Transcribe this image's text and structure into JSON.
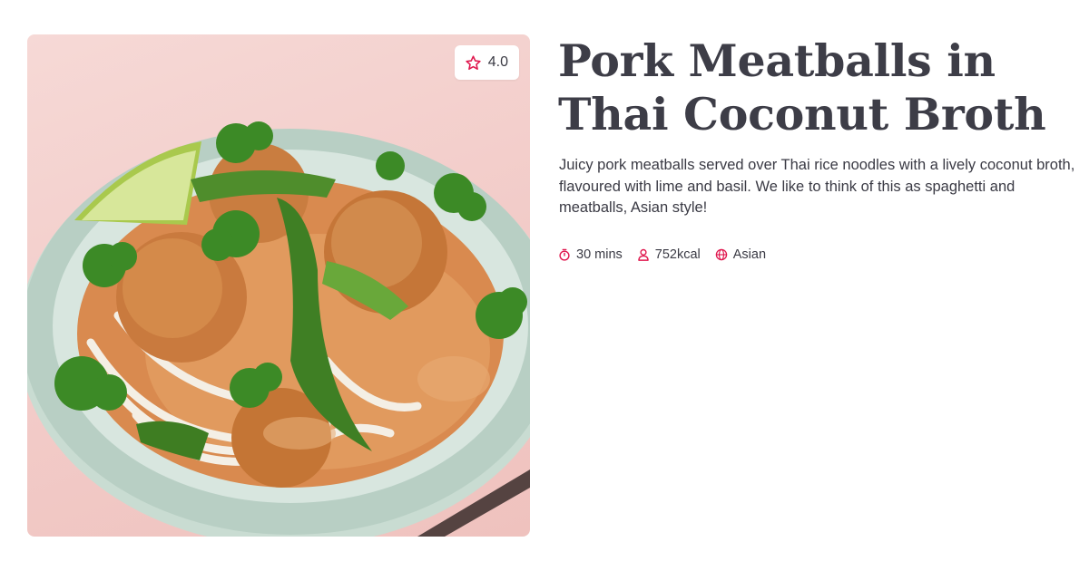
{
  "recipe": {
    "title": "Pork Meatballs in Thai Coconut Broth",
    "description": "Juicy pork meatballs served over Thai rice noodles with a lively coconut broth, flavoured with lime and basil. We like to think of this as spaghetti and meatballs, Asian style!",
    "rating": "4.0",
    "image_alt": "Bowl of pork meatballs in orange coconut broth over rice noodles with snow peas, coriander and a lime wedge"
  },
  "meta": {
    "time": "30 mins",
    "calories": "752kcal",
    "cuisine": "Asian"
  },
  "icons": {
    "rating": "star-icon",
    "time": "stopwatch-icon",
    "calories": "person-icon",
    "cuisine": "globe-icon"
  },
  "colors": {
    "accent": "#e0194f",
    "text": "#3a3a44",
    "title": "#3d3d47",
    "background": "#ffffff"
  }
}
